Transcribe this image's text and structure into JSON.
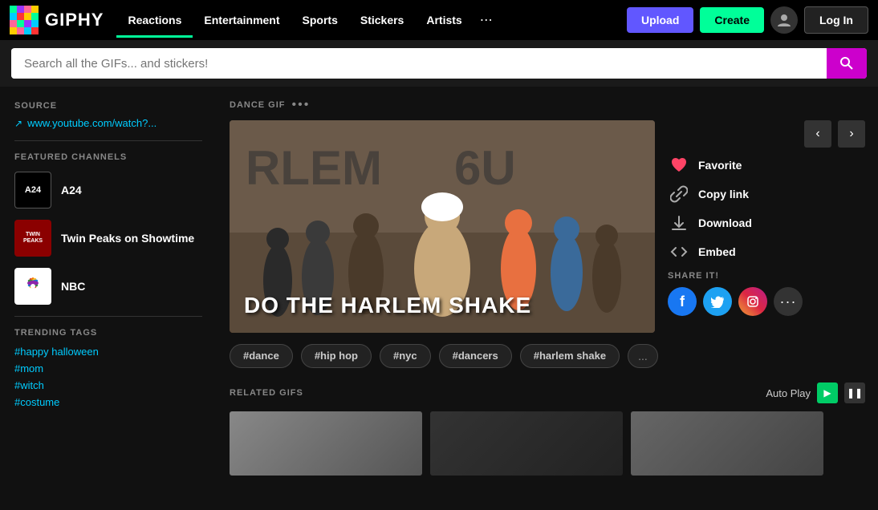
{
  "header": {
    "logo_text": "GIPHY",
    "nav_items": [
      {
        "label": "Reactions",
        "id": "reactions",
        "active": true,
        "color": "#00ff99"
      },
      {
        "label": "Entertainment",
        "id": "entertainment",
        "active": false,
        "color": "#9933ff"
      },
      {
        "label": "Sports",
        "id": "sports",
        "active": false,
        "color": "#00ccff"
      },
      {
        "label": "Stickers",
        "id": "stickers",
        "active": false,
        "color": "#ff6699"
      },
      {
        "label": "Artists",
        "id": "artists",
        "active": false,
        "color": "#ffcc00"
      }
    ],
    "upload_label": "Upload",
    "create_label": "Create",
    "login_label": "Log In"
  },
  "search": {
    "placeholder": "Search all the GIFs... and stickers!"
  },
  "sidebar": {
    "source_title": "SOURCE",
    "source_link": "www.youtube.com/watch?...",
    "featured_title": "FEATURED CHANNELS",
    "channels": [
      {
        "id": "a24",
        "abbr": "A24",
        "name": "A24"
      },
      {
        "id": "twinpeaks",
        "abbr": "TWIN PEAKS",
        "name": "Twin Peaks on Showtime"
      },
      {
        "id": "nbc",
        "abbr": "NBC",
        "name": "NBC"
      }
    ],
    "trending_title": "TRENDING TAGS",
    "tags": [
      "#happy halloween",
      "#mom",
      "#witch",
      "#costume"
    ]
  },
  "gif": {
    "label": "DANCE GIF",
    "title_overlay": "DO THE HARLEM SHAKE",
    "actions": {
      "favorite_label": "Favorite",
      "copy_link_label": "Copy link",
      "download_label": "Download",
      "embed_label": "Embed"
    },
    "share_label": "SHARE IT!"
  },
  "tags": {
    "items": [
      "#dance",
      "#hip hop",
      "#nyc",
      "#dancers",
      "#harlem shake"
    ],
    "more": "..."
  },
  "related": {
    "title": "RELATED GIFS",
    "autoplay_label": "Auto Play"
  }
}
